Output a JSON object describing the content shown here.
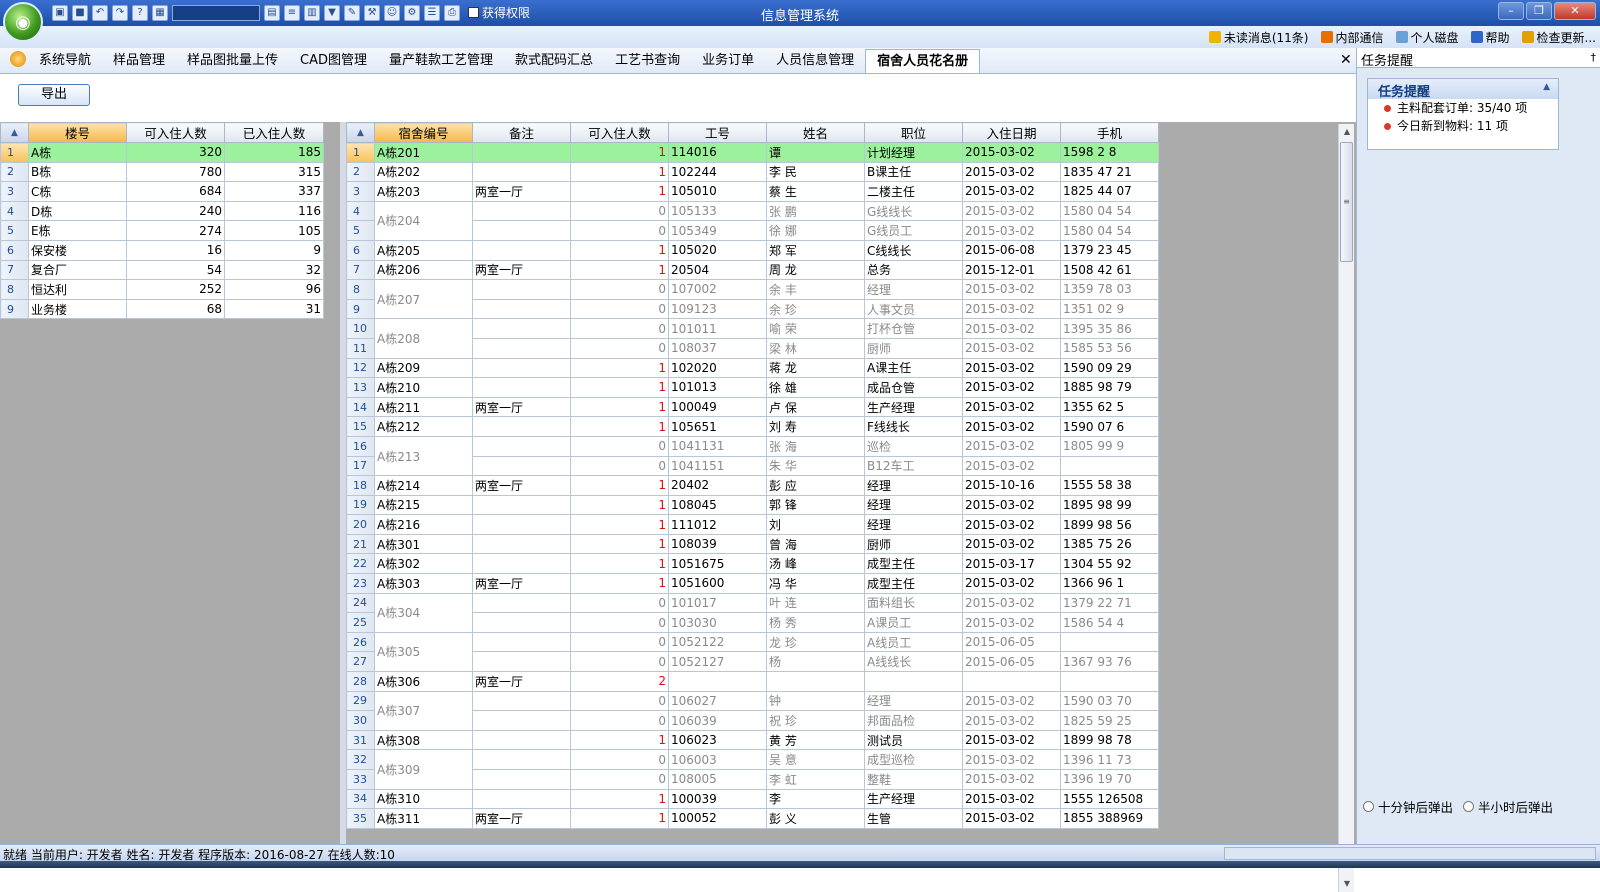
{
  "window": {
    "title": "信息管理系统",
    "perm_label": "获得权限"
  },
  "menu": [
    {
      "label": "未读消息(11条)",
      "icon": "mail-icon",
      "color": "#f0b400"
    },
    {
      "label": "内部通信",
      "icon": "chat-icon",
      "color": "#e56f00"
    },
    {
      "label": "个人磁盘",
      "icon": "disk-icon",
      "color": "#6aa0d8"
    },
    {
      "label": "帮助",
      "icon": "help-icon",
      "color": "#2d66c4"
    },
    {
      "label": "检查更新...",
      "icon": "update-icon",
      "color": "#e0a000"
    }
  ],
  "tabs": [
    "系统导航",
    "样品管理",
    "样品图批量上传",
    "CAD图管理",
    "量产鞋款工艺管理",
    "款式配码汇总",
    "工艺书查询",
    "业务订单",
    "人员信息管理",
    "宿舍人员花名册"
  ],
  "active_tab": 9,
  "export_label": "导出",
  "buildings": {
    "headers": [
      "楼号",
      "可入住人数",
      "已入住人数"
    ],
    "rows": [
      [
        "A栋",
        "320",
        "185"
      ],
      [
        "B栋",
        "780",
        "315"
      ],
      [
        "C栋",
        "684",
        "337"
      ],
      [
        "D栋",
        "240",
        "116"
      ],
      [
        "E栋",
        "274",
        "105"
      ],
      [
        "保安楼",
        "16",
        "9"
      ],
      [
        "复合厂",
        "54",
        "32"
      ],
      [
        "恒达利",
        "252",
        "96"
      ],
      [
        "业务楼",
        "68",
        "31"
      ]
    ]
  },
  "dorm": {
    "headers": [
      "宿舍编号",
      "备注",
      "可入住人数",
      "工号",
      "姓名",
      "职位",
      "入住日期",
      "手机"
    ],
    "rows": [
      [
        "A栋201",
        "",
        "1",
        "114016",
        "谭",
        "计划经理",
        "2015-03-02",
        "1598   2   8"
      ],
      [
        "A栋202",
        "",
        "1",
        "102244",
        "李  民",
        "B课主任",
        "2015-03-02",
        "1835  47   21"
      ],
      [
        "A栋203",
        "两室一厅",
        "1",
        "105010",
        "蔡  生",
        "二楼主任",
        "2015-03-02",
        "1825  44   07"
      ],
      [
        "A栋204",
        "",
        "0",
        "105133",
        "张  鹏",
        "G线线长",
        "2015-03-02",
        "1580  04   54"
      ],
      [
        "",
        "",
        "0",
        "105349",
        "徐  娜",
        "G线员工",
        "2015-03-02",
        "1580  04   54"
      ],
      [
        "A栋205",
        "",
        "1",
        "105020",
        "郑  军",
        "C线线长",
        "2015-06-08",
        "1379  23   45"
      ],
      [
        "A栋206",
        "两室一厅",
        "1",
        "20504",
        "周  龙",
        "总务",
        "2015-12-01",
        "1508  42   61"
      ],
      [
        "A栋207",
        "",
        "0",
        "107002",
        "余  丰",
        "经理",
        "2015-03-02",
        "1359  78   03"
      ],
      [
        "",
        "",
        "0",
        "109123",
        "余  珍",
        "人事文员",
        "2015-03-02",
        "1351  02   9"
      ],
      [
        "A栋208",
        "",
        "0",
        "101011",
        "喻  荣",
        "打杯仓管",
        "2015-03-02",
        "1395  35   86"
      ],
      [
        "",
        "",
        "0",
        "108037",
        "梁  林",
        "厨师",
        "2015-03-02",
        "1585  53   56"
      ],
      [
        "A栋209",
        "",
        "1",
        "102020",
        "蒋  龙",
        "A课主任",
        "2015-03-02",
        "1590  09   29"
      ],
      [
        "A栋210",
        "",
        "1",
        "101013",
        "徐  雄",
        "成品仓管",
        "2015-03-02",
        "1885  98   79"
      ],
      [
        "A栋211",
        "两室一厅",
        "1",
        "100049",
        "卢  保",
        "生产经理",
        "2015-03-02",
        "1355  62   5"
      ],
      [
        "A栋212",
        "",
        "1",
        "105651",
        "刘  寿",
        "F线线长",
        "2015-03-02",
        "1590  07   6"
      ],
      [
        "A栋213",
        "",
        "0",
        "1041131",
        "张  海",
        "巡检",
        "2015-03-02",
        "1805  99   9"
      ],
      [
        "",
        "",
        "0",
        "1041151",
        "朱  华",
        "B12车工",
        "2015-03-02",
        ""
      ],
      [
        "A栋214",
        "两室一厅",
        "1",
        "20402",
        "彭  应",
        "经理",
        "2015-10-16",
        "1555  58   38"
      ],
      [
        "A栋215",
        "",
        "1",
        "108045",
        "郭  锋",
        "经理",
        "2015-03-02",
        "1895  98   99"
      ],
      [
        "A栋216",
        "",
        "1",
        "111012",
        "刘",
        "经理",
        "2015-03-02",
        "1899  98   56"
      ],
      [
        "A栋301",
        "",
        "1",
        "108039",
        "曾  海",
        "厨师",
        "2015-03-02",
        "1385  75   26"
      ],
      [
        "A栋302",
        "",
        "1",
        "1051675",
        "汤  峰",
        "成型主任",
        "2015-03-17",
        "1304  55   92"
      ],
      [
        "A栋303",
        "两室一厅",
        "1",
        "1051600",
        "冯  华",
        "成型主任",
        "2015-03-02",
        "1366  96   1"
      ],
      [
        "A栋304",
        "",
        "0",
        "101017",
        "叶  连",
        "面料组长",
        "2015-03-02",
        "1379  22   71"
      ],
      [
        "",
        "",
        "0",
        "103030",
        "杨  秀",
        "A课员工",
        "2015-03-02",
        "1586  54   4"
      ],
      [
        "A栋305",
        "",
        "0",
        "1052122",
        "龙  珍",
        "A线员工",
        "2015-06-05",
        ""
      ],
      [
        "",
        "",
        "0",
        "1052127",
        "杨",
        "A线线长",
        "2015-06-05",
        "1367  93   76"
      ],
      [
        "A栋306",
        "两室一厅",
        "2",
        "",
        "",
        "",
        "",
        ""
      ],
      [
        "A栋307",
        "",
        "0",
        "106027",
        "钟",
        "经理",
        "2015-03-02",
        "1590  03   70"
      ],
      [
        "",
        "",
        "0",
        "106039",
        "祝  珍",
        "邦面品检",
        "2015-03-02",
        "1825  59   25"
      ],
      [
        "A栋308",
        "",
        "1",
        "106023",
        "黄  芳",
        "测试员",
        "2015-03-02",
        "1899  98   78"
      ],
      [
        "A栋309",
        "",
        "0",
        "106003",
        "吴  意",
        "成型巡检",
        "2015-03-02",
        "1396  11   73"
      ],
      [
        "",
        "",
        "0",
        "108005",
        "李  虹",
        "整鞋",
        "2015-03-02",
        "1396  19   70"
      ],
      [
        "A栋310",
        "",
        "1",
        "100039",
        "李",
        "生产经理",
        "2015-03-02",
        "1555  126508"
      ],
      [
        "A栋311",
        "两室一厅",
        "1",
        "100052",
        "彭  义",
        "生管",
        "2015-03-02",
        "1855  388969"
      ]
    ]
  },
  "side": {
    "head": "任务提醒",
    "box_title": "任务提醒",
    "items": [
      "主料配套订单: 35/40 项",
      "今日新到物料: 11 项"
    ],
    "radios": [
      "十分钟后弹出",
      "半小时后弹出"
    ]
  },
  "status": "就绪  当前用户: 开发者  姓名: 开发者  程序版本: 2016-08-27  在线人数:10"
}
